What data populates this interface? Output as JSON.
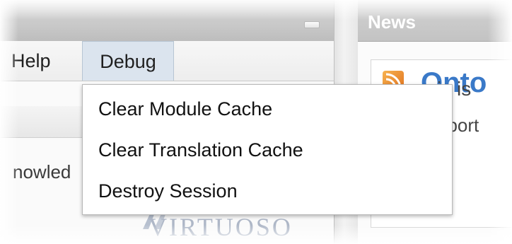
{
  "menubar": {
    "help_label": "Help",
    "debug_label": "Debug"
  },
  "debug_menu": {
    "items": [
      {
        "label": "Clear Module Cache"
      },
      {
        "label": "Clear Translation Cache"
      },
      {
        "label": "Destroy Session"
      }
    ]
  },
  "main": {
    "partial_text": "nowled",
    "logo_text": "VIRTUOSO"
  },
  "news": {
    "title": "News",
    "heading_partial": "Onto",
    "line1_partial": "is is",
    "line2_partial": "pport"
  },
  "colors": {
    "menu_active_bg": "#dbe4ee",
    "news_heading": "#3a79c8",
    "rss_orange": "#e0711e"
  }
}
